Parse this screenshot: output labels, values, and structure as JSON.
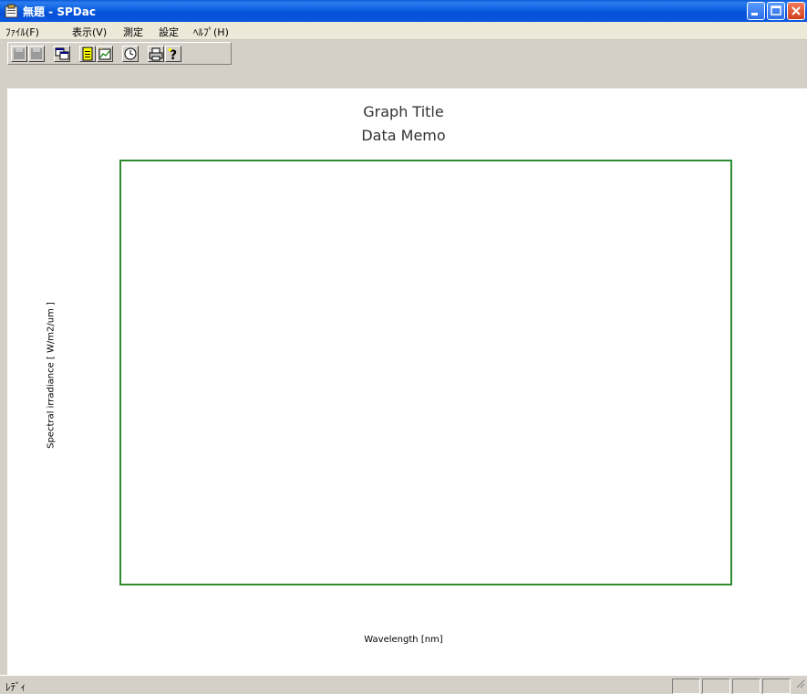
{
  "window": {
    "title": "無題 - SPDac",
    "controls": [
      "minimize-icon",
      "maximize-icon",
      "close-icon"
    ]
  },
  "menu": {
    "items": [
      {
        "label": "ﾌｧｲﾙ(F)"
      },
      {
        "label": "表示(V)"
      },
      {
        "label": "測定"
      },
      {
        "label": "設定"
      },
      {
        "label": "ﾍﾙﾌﾟ(H)"
      }
    ]
  },
  "toolbar": {
    "buttons": [
      {
        "icon": "save-disabled-icon"
      },
      {
        "icon": "save-all-disabled-icon"
      },
      {
        "icon": "copy-window-icon"
      },
      {
        "icon": "note-icon"
      },
      {
        "icon": "new-graph-icon"
      },
      {
        "icon": "clock-icon"
      },
      {
        "icon": "print-icon"
      },
      {
        "icon": "help-icon"
      }
    ]
  },
  "graph": {
    "title": "Graph Title",
    "memo": "Data Memo",
    "xlabel": "Wavelength [nm]",
    "ylabel": "Spectral irradiance [ W/m2/um ]",
    "frame_color": "#2e8b2e"
  },
  "chart_data": {
    "type": "line",
    "title": "Graph Title",
    "subtitle": "Data Memo",
    "xlabel": "Wavelength [nm]",
    "ylabel": "Spectral irradiance [ W/m2/um ]",
    "series": []
  },
  "status": {
    "text": "ﾚﾃﾞｨ"
  }
}
